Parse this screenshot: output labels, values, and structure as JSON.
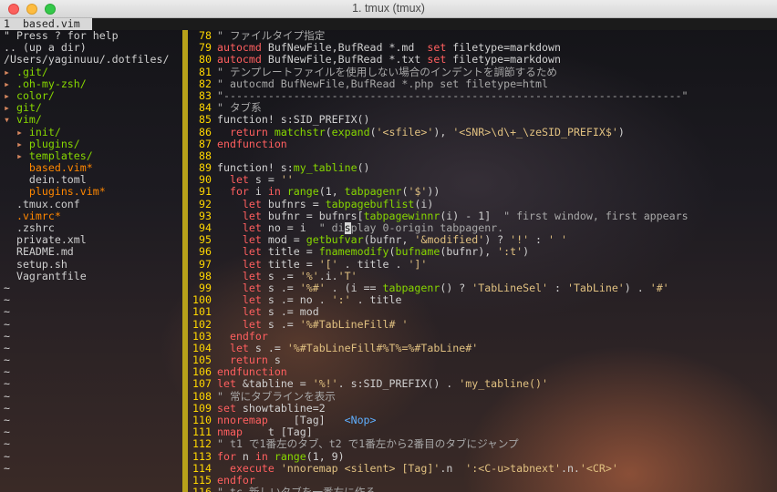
{
  "window": {
    "title": "1. tmux (tmux)"
  },
  "tab": {
    "label": "1  based.vim "
  },
  "tree": {
    "help": "\" Press ? for help",
    "up": ".. (up a dir)",
    "root": "/Users/yaginuuu/.dotfiles/",
    "items": [
      {
        "text": ".git/",
        "kind": "dir",
        "arrow": "▸ "
      },
      {
        "text": ".oh-my-zsh/",
        "kind": "dir",
        "arrow": "▸ "
      },
      {
        "text": "color/",
        "kind": "dir",
        "arrow": "▸ "
      },
      {
        "text": "git/",
        "kind": "dir",
        "arrow": "▸ "
      },
      {
        "text": "vim/",
        "kind": "dir",
        "arrow": "▾ "
      },
      {
        "text": "init/",
        "kind": "dir",
        "arrow": "  ▸ "
      },
      {
        "text": "plugins/",
        "kind": "dir",
        "arrow": "  ▸ "
      },
      {
        "text": "templates/",
        "kind": "dir",
        "arrow": "  ▸ "
      },
      {
        "text": "based.vim*",
        "kind": "mod",
        "arrow": "    "
      },
      {
        "text": "dein.toml",
        "kind": "file",
        "arrow": "    "
      },
      {
        "text": "plugins.vim*",
        "kind": "mod",
        "arrow": "    "
      },
      {
        "text": ".tmux.conf",
        "kind": "file",
        "arrow": "  "
      },
      {
        "text": ".vimrc*",
        "kind": "mod",
        "arrow": "  "
      },
      {
        "text": ".zshrc",
        "kind": "file",
        "arrow": "  "
      },
      {
        "text": "private.xml",
        "kind": "file",
        "arrow": "  "
      },
      {
        "text": "README.md",
        "kind": "file",
        "arrow": "  "
      },
      {
        "text": "setup.sh",
        "kind": "file",
        "arrow": "  "
      },
      {
        "text": "Vagrantfile",
        "kind": "file",
        "arrow": "  "
      }
    ],
    "tilde_rows": 16
  },
  "code": {
    "lines": [
      {
        "n": "78",
        "t": "\" ファイルタイプ指定"
      },
      {
        "n": "79",
        "t": "autocmd BufNewFile,BufRead *.md  set filetype=markdown"
      },
      {
        "n": "80",
        "t": "autocmd BufNewFile,BufRead *.txt set filetype=markdown"
      },
      {
        "n": "81",
        "t": "\" テンプレートファイルを使用しない場合のインデントを調節するため"
      },
      {
        "n": "82",
        "t": "\" autocmd BufNewFile,BufRead *.php set filetype=html"
      },
      {
        "n": "83",
        "t": "\"------------------------------------------------------------------------\""
      },
      {
        "n": "84",
        "t": "\" タブ系"
      },
      {
        "n": "85",
        "t": "function! s:SID_PREFIX()"
      },
      {
        "n": "86",
        "t": "  return matchstr(expand('<sfile>'), '<SNR>\\d\\+_\\zeSID_PREFIX$')"
      },
      {
        "n": "87",
        "t": "endfunction"
      },
      {
        "n": "88",
        "t": ""
      },
      {
        "n": "89",
        "t": "function! s:my_tabline()"
      },
      {
        "n": "90",
        "t": "  let s = ''"
      },
      {
        "n": "91",
        "t": "  for i in range(1, tabpagenr('$'))"
      },
      {
        "n": "92",
        "t": "    let bufnrs = tabpagebuflist(i)"
      },
      {
        "n": "93",
        "t": "    let bufnr = bufnrs[tabpagewinnr(i) - 1]  \" first window, first appears"
      },
      {
        "n": "94",
        "t": "    let no = i  \" display 0-origin tabpagenr."
      },
      {
        "n": "95",
        "t": "    let mod = getbufvar(bufnr, '&modified') ? '!' : ' '"
      },
      {
        "n": "96",
        "t": "    let title = fnamemodify(bufname(bufnr), ':t')"
      },
      {
        "n": "97",
        "t": "    let title = '[' . title . ']'"
      },
      {
        "n": "98",
        "t": "    let s .= '%'.i.'T'"
      },
      {
        "n": "99",
        "t": "    let s .= '%#' . (i == tabpagenr() ? 'TabLineSel' : 'TabLine') . '#'"
      },
      {
        "n": "100",
        "t": "    let s .= no . ':' . title"
      },
      {
        "n": "101",
        "t": "    let s .= mod"
      },
      {
        "n": "102",
        "t": "    let s .= '%#TabLineFill# '"
      },
      {
        "n": "103",
        "t": "  endfor"
      },
      {
        "n": "104",
        "t": "  let s .= '%#TabLineFill#%T%=%#TabLine#'"
      },
      {
        "n": "105",
        "t": "  return s"
      },
      {
        "n": "106",
        "t": "endfunction"
      },
      {
        "n": "107",
        "t": "let &tabline = '%!'. s:SID_PREFIX() . 'my_tabline()'"
      },
      {
        "n": "108",
        "t": "\" 常にタブラインを表示"
      },
      {
        "n": "109",
        "t": "set showtabline=2"
      },
      {
        "n": "110",
        "t": "nnoremap    [Tag]   <Nop>"
      },
      {
        "n": "111",
        "t": "nmap    t [Tag]"
      },
      {
        "n": "112",
        "t": "\" t1 で1番左のタブ、t2 で1番左から2番目のタブにジャンプ"
      },
      {
        "n": "113",
        "t": "for n in range(1, 9)"
      },
      {
        "n": "114",
        "t": "  execute 'nnoremap <silent> [Tag]'.n  ':<C-u>tabnext'.n.'<CR>'"
      },
      {
        "n": "115",
        "t": "endfor"
      },
      {
        "n": "116",
        "t": "\" tc 新しいタブを一番右に作る"
      }
    ]
  }
}
